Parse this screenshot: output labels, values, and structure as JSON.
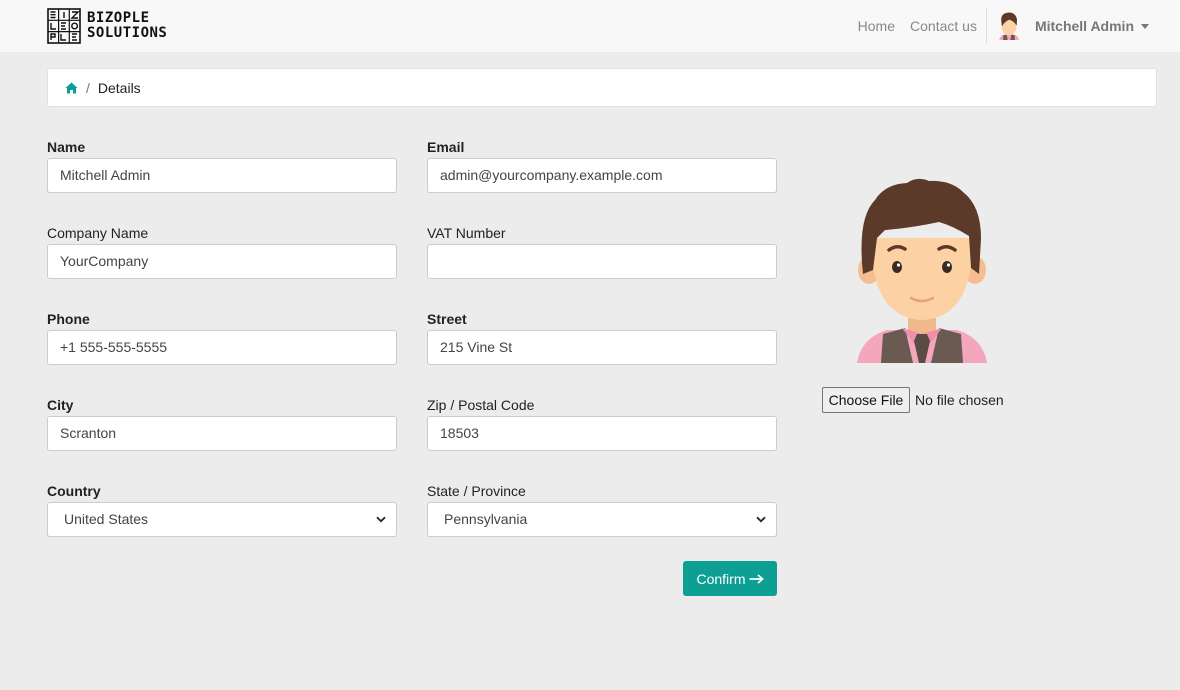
{
  "brand": {
    "line1": "BIZOPLE",
    "line2": "SOLUTIONS"
  },
  "nav": {
    "home": "Home",
    "contact": "Contact us",
    "user": "Mitchell Admin"
  },
  "breadcrumb": {
    "home_icon": "home-icon",
    "separator": "/",
    "current": "Details"
  },
  "form": {
    "name": {
      "label": "Name",
      "value": "Mitchell Admin"
    },
    "email": {
      "label": "Email",
      "value": "admin@yourcompany.example.com"
    },
    "company": {
      "label": "Company Name",
      "value": "YourCompany"
    },
    "vat": {
      "label": "VAT Number",
      "value": ""
    },
    "phone": {
      "label": "Phone",
      "value": "+1 555-555-5555"
    },
    "street": {
      "label": "Street",
      "value": "215 Vine St"
    },
    "city": {
      "label": "City",
      "value": "Scranton"
    },
    "zip": {
      "label": "Zip / Postal Code",
      "value": "18503"
    },
    "country": {
      "label": "Country",
      "value": "United States"
    },
    "state": {
      "label": "State / Province",
      "value": "Pennsylvania"
    },
    "confirm": "Confirm"
  },
  "avatar_upload": {
    "button": "Choose File",
    "status": "No file chosen"
  },
  "colors": {
    "accent": "#0d9e94",
    "background": "#ececec",
    "navbar": "#f8f8f8"
  }
}
